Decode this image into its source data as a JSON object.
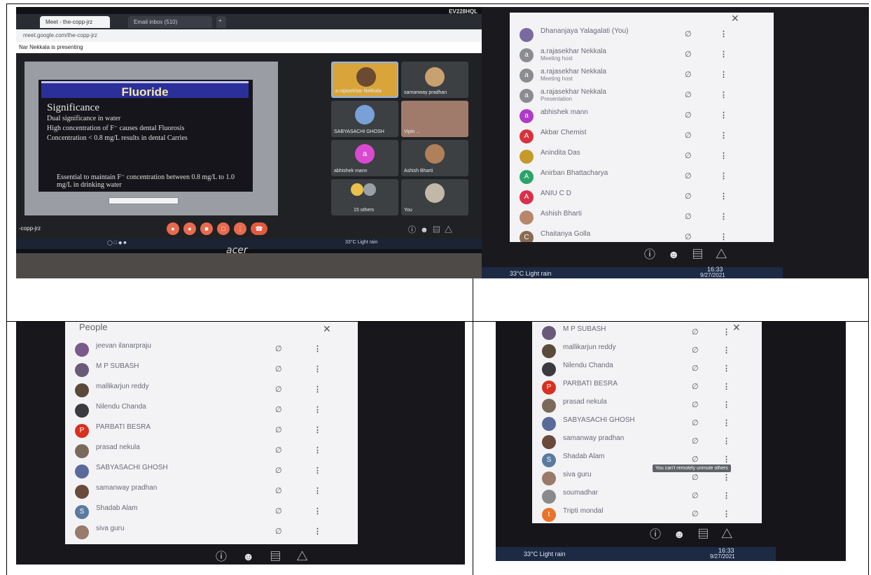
{
  "photo1": {
    "monitor_model": "EV228HQL",
    "tabs": [
      {
        "label": "Meet - the-copp-jrz"
      },
      {
        "label": "Email inbox (510)"
      }
    ],
    "address": "meet.google.com/the-copp-jrz",
    "presenting": "Nar Nekkala is presenting",
    "slide": {
      "title": "Fluoride",
      "heading": "Significance",
      "lines": [
        "Dual significance in water",
        "High concentration of F⁻  causes dental  Fluorosis",
        "Concentration < 0.8 mg/L results in dental Carries"
      ],
      "note": "Essential to maintain  F⁻  concentration  between 0.8 mg/L to 1.0 mg/L in drinking water"
    },
    "tiles": [
      {
        "name": "a.rajasekhar Nekkala"
      },
      {
        "name": "samanway pradhan"
      },
      {
        "name": "SABYASACHI GHOSH"
      },
      {
        "name": "Vipin ..."
      },
      {
        "name": "abhishek mann"
      },
      {
        "name": "Ashish Bharti"
      },
      {
        "name": "15 others"
      },
      {
        "name": "You"
      }
    ],
    "meeting_code": "-copp-jrz",
    "taskbar_weather": "33°C  Light rain",
    "acer": "acer"
  },
  "photo2": {
    "participants": [
      {
        "name": "Dhananjaya Yalagalati (You)",
        "sub": "",
        "initial": "",
        "color": "#7a6aa0"
      },
      {
        "name": "a.rajasekhar Nekkala",
        "sub": "Meeting host",
        "initial": "a",
        "color": "#8a8c90"
      },
      {
        "name": "a.rajasekhar Nekkala",
        "sub": "Meeting host",
        "initial": "a",
        "color": "#8a8c90"
      },
      {
        "name": "a.rajasekhar Nekkala",
        "sub": "Presentation",
        "initial": "a",
        "color": "#8a8c90"
      },
      {
        "name": "abhishek mann",
        "sub": "",
        "initial": "a",
        "color": "#b03ac8"
      },
      {
        "name": "Akbar Chemist",
        "sub": "",
        "initial": "A",
        "color": "#d8323a"
      },
      {
        "name": "Anindita Das",
        "sub": "",
        "initial": "",
        "color": "#c59a2a"
      },
      {
        "name": "Anirban Bhattacharya",
        "sub": "",
        "initial": "A",
        "color": "#2aa46a"
      },
      {
        "name": "ANIU C D",
        "sub": "",
        "initial": "A",
        "color": "#d9304a"
      },
      {
        "name": "Ashish Bharti",
        "sub": "",
        "initial": "",
        "color": "#b8866a"
      },
      {
        "name": "Chaitanya Golla",
        "sub": "",
        "initial": "C",
        "color": "#8a6a50"
      }
    ],
    "taskbar": {
      "weather": "33°C  Light rain",
      "time": "16:33",
      "date": "9/27/2021"
    }
  },
  "photo3": {
    "title": "People",
    "participants": [
      {
        "name": "jeevan ilanarpraju",
        "initial": "",
        "color": "#7a5a8a"
      },
      {
        "name": "M P SUBASH",
        "initial": "",
        "color": "#6a5a7a"
      },
      {
        "name": "mallikarjun reddy",
        "initial": "",
        "color": "#5a4a3a"
      },
      {
        "name": "Nilendu Chanda",
        "initial": "",
        "color": "#3a3a40"
      },
      {
        "name": "PARBATI BESRA",
        "initial": "P",
        "color": "#d83020"
      },
      {
        "name": "prasad nekula",
        "initial": "",
        "color": "#7a6a5a"
      },
      {
        "name": "SABYASACHI GHOSH",
        "initial": "",
        "color": "#5a6a9a"
      },
      {
        "name": "samanway pradhan",
        "initial": "",
        "color": "#6a4a3a"
      },
      {
        "name": "Shadab Alam",
        "initial": "S",
        "color": "#5a7aa0"
      },
      {
        "name": "siva guru",
        "initial": "",
        "color": "#9a7a6a"
      }
    ]
  },
  "photo4": {
    "participants": [
      {
        "name": "M P SUBASH",
        "initial": "",
        "color": "#6a5a7a"
      },
      {
        "name": "mallikarjun reddy",
        "initial": "",
        "color": "#5a4a3a"
      },
      {
        "name": "Nilendu Chanda",
        "initial": "",
        "color": "#3a3a40"
      },
      {
        "name": "PARBATI BESRA",
        "initial": "P",
        "color": "#d83020"
      },
      {
        "name": "prasad nekula",
        "initial": "",
        "color": "#7a6a5a"
      },
      {
        "name": "SABYASACHI GHOSH",
        "initial": "",
        "color": "#5a6a9a"
      },
      {
        "name": "samanway pradhan",
        "initial": "",
        "color": "#6a4a3a"
      },
      {
        "name": "Shadab Alam",
        "initial": "S",
        "color": "#5a7aa0"
      },
      {
        "name": "siva guru",
        "initial": "",
        "color": "#9a7a6a"
      },
      {
        "name": "soumadhar",
        "initial": "",
        "color": "#8a8a8a"
      },
      {
        "name": "Tripti mondal",
        "initial": "t",
        "color": "#e8742a"
      }
    ],
    "tooltip": "You can't remotely unmute others",
    "taskbar": {
      "weather": "33°C  Light rain",
      "time": "16:33",
      "date": "9/27/2021"
    }
  }
}
